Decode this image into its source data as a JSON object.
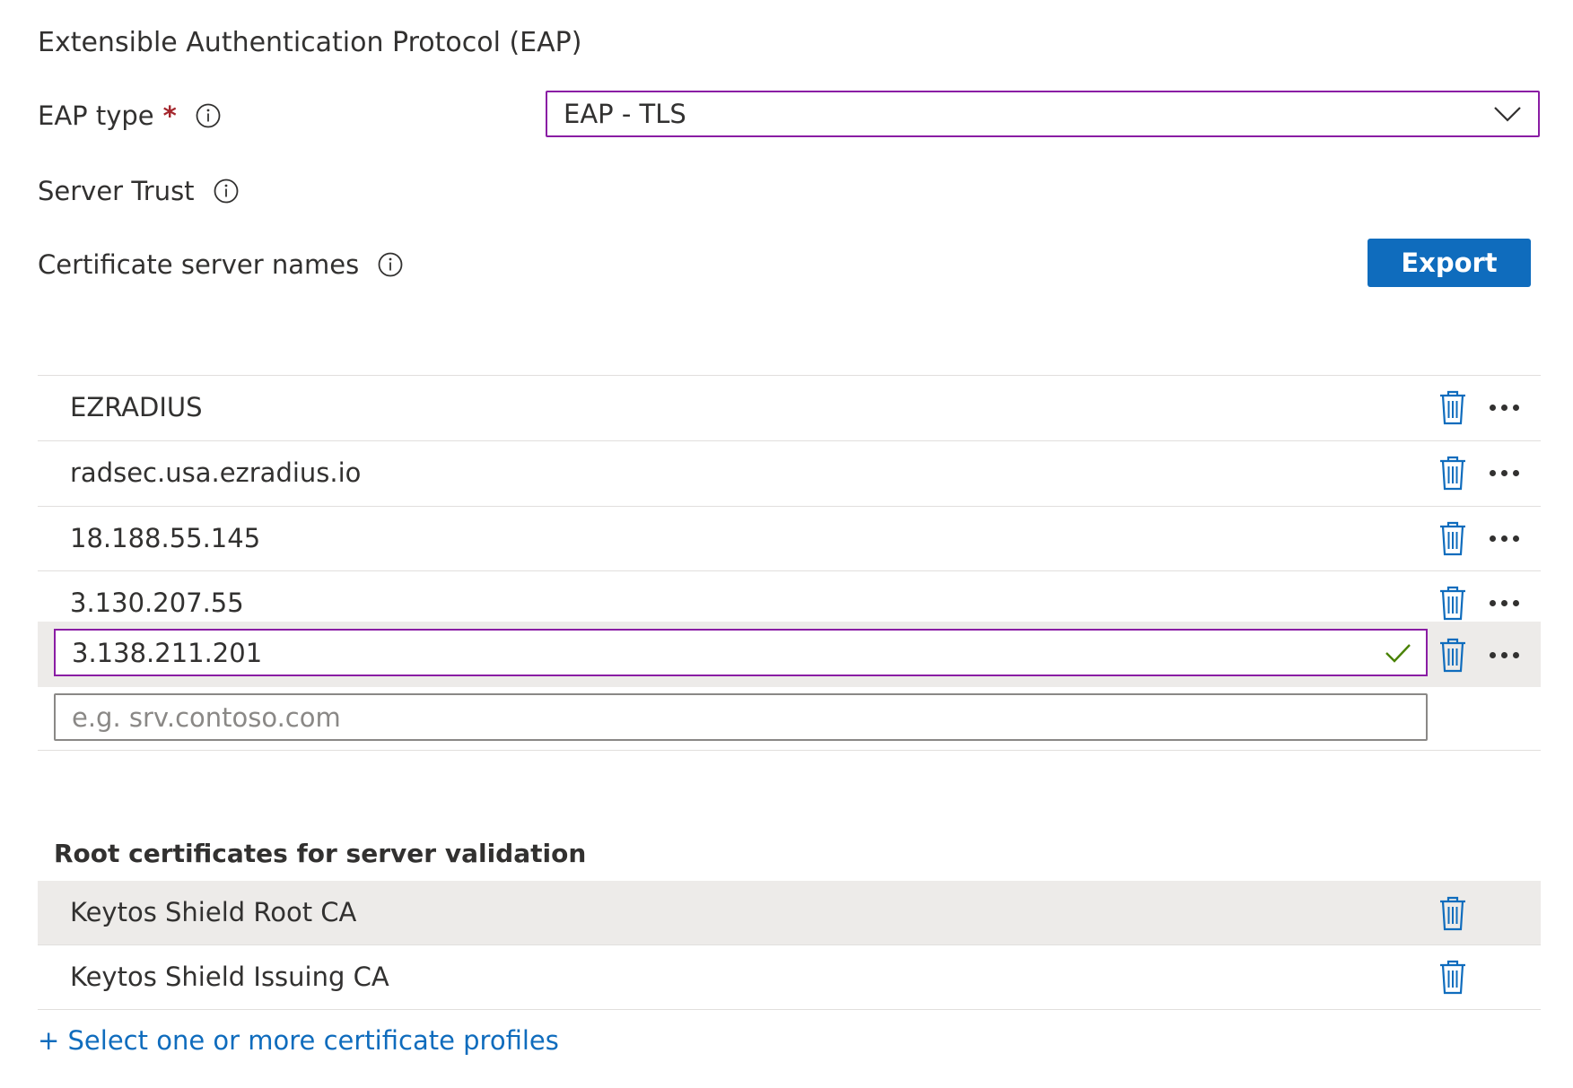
{
  "section": {
    "title": "Extensible Authentication Protocol (EAP)"
  },
  "eap_type": {
    "label": "EAP type",
    "required_marker": "*",
    "value": "EAP - TLS"
  },
  "server_trust": {
    "label": "Server Trust"
  },
  "cert_names": {
    "label": "Certificate server names",
    "export_label": "Export",
    "items": [
      "EZRADIUS",
      "radsec.usa.ezradius.io",
      "18.188.55.145",
      "3.130.207.55"
    ],
    "editing_value": "3.138.211.201",
    "new_placeholder": "e.g. srv.contoso.com"
  },
  "root_certs": {
    "title": "Root certificates for server validation",
    "items": [
      "Keytos Shield Root CA",
      "Keytos Shield Issuing CA"
    ],
    "add_link": "+ Select one or more certificate profiles"
  },
  "colors": {
    "accent": "#0f6cbd",
    "focus_border": "#8a1da4",
    "valid_check": "#498205",
    "selected_row": "#edebe9"
  }
}
